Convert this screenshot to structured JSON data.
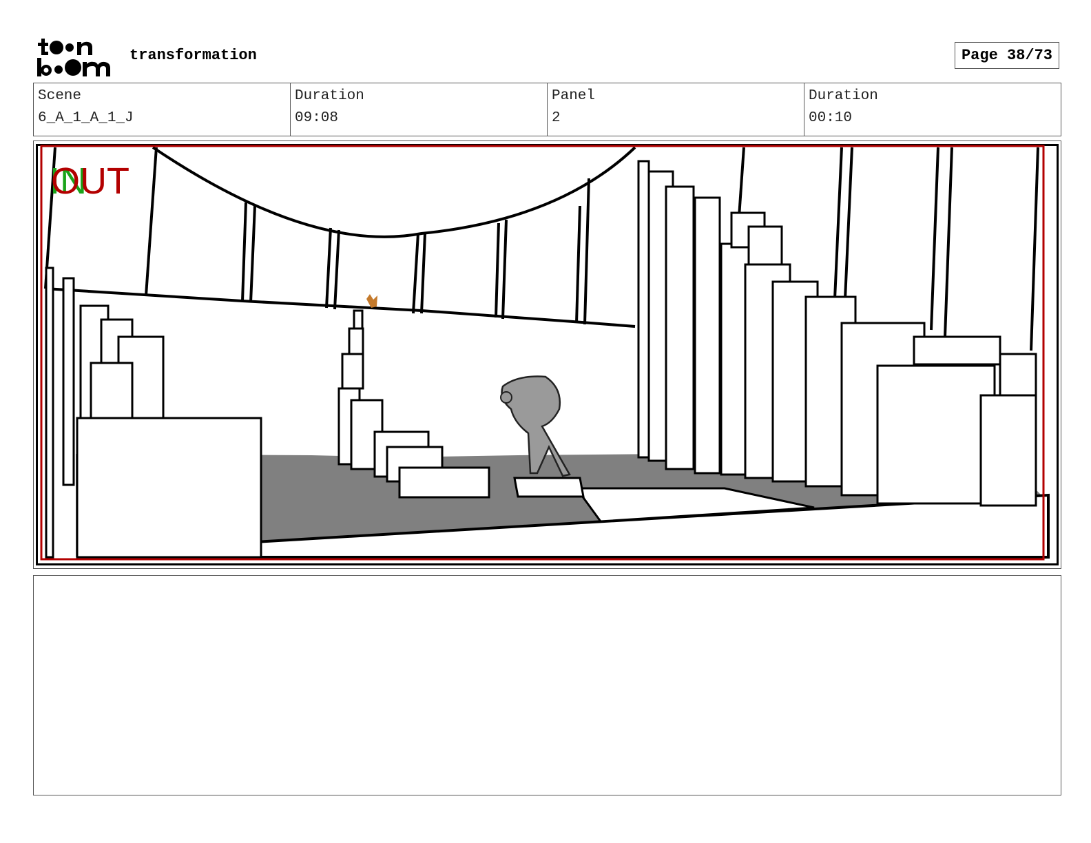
{
  "header": {
    "logo_text_top": "toon",
    "logo_text_bottom": "boom",
    "project_title": "transformation",
    "page_label": "Page 38/73"
  },
  "info": {
    "scene_label": "Scene",
    "scene_value": "6_A_1_A_1_J",
    "scene_duration_label": "Duration",
    "scene_duration_value": "09:08",
    "panel_label": "Panel",
    "panel_value": "2",
    "panel_duration_label": "Duration",
    "panel_duration_value": "00:10"
  },
  "panel": {
    "marker_in": "IN",
    "marker_out": "OUT",
    "frame_color": "#b30000",
    "in_color": "#1aa31a",
    "ground_color": "#808080"
  },
  "notes": {
    "text": ""
  }
}
